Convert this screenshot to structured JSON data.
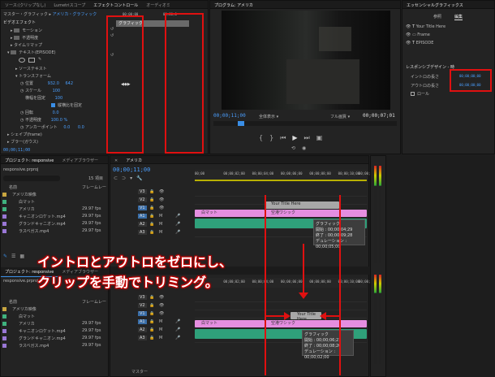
{
  "effect_controls": {
    "tabs": [
      "ソース:(クリップなし)",
      "Lumetriスコープ",
      "エフェクトコントロール",
      "オーディオミ"
    ],
    "master": "マスター・グラフィック",
    "clip": "アメリカ・グラフィック",
    "timecode_start": "00;00;00",
    "timecode_end": "00;00;0",
    "graphic_label": "グラフィック",
    "section_video": "ビデオエフェクト",
    "rows": [
      "モーション",
      "不透明度",
      "タイムリマップ",
      "テキスト(EPISODE)",
      "ソーステキスト",
      "トランスフォーム",
      "位置",
      "スケール",
      "横幅を固定",
      "回転",
      "不透明度",
      "アンカーポイント",
      "シェイプ(frame)",
      "ブラー(ガウス)"
    ],
    "position_x": "932.0",
    "position_y": "642",
    "scale": "100",
    "scale_w": "100",
    "rotation": "0.0",
    "opacity": "100.0 %",
    "anchor_x": "0.0",
    "anchor_y": "0.0",
    "checkbox_label": "縦横比を固定",
    "footer_timecode": "00;00;11;00"
  },
  "program": {
    "tab": "プログラム: アメリカ",
    "timecode": "00;00;11;00",
    "fit": "全体表示",
    "quality": "フル画質",
    "duration": "00;00;07;01"
  },
  "essential": {
    "tab": "エッセンシャルグラフィックス",
    "subtabs": [
      "参照",
      "編集"
    ],
    "layers": [
      "Your Title Here",
      "Frame",
      "EPISODE"
    ],
    "responsive_title": "レスポンシブデザイン - 時",
    "intro_label": "イントロの長さ",
    "intro_value": "00;00;00;00",
    "outro_label": "アウトロの長さ",
    "outro_value": "00;00;00;00",
    "roll_label": "ロール"
  },
  "project": {
    "tabs": [
      "プロジェクト: responsive",
      "メディアブラウザー"
    ],
    "file": "responsive.prproj",
    "count": "15 項目",
    "col_name": "名前",
    "col_rate": "フレームレー",
    "items": [
      {
        "name": "アメリカ映像",
        "rate": "",
        "color": "#c8a640"
      },
      {
        "name": "白マット",
        "rate": "",
        "color": "#3fb27f"
      },
      {
        "name": "アメリカ",
        "rate": "29.97 fps",
        "color": "#3fb27f"
      },
      {
        "name": "キャニオンロケット.mp4",
        "rate": "29.97 fps",
        "color": "#9a77d6"
      },
      {
        "name": "グランドキャニオン.mp4",
        "rate": "29.97 fps",
        "color": "#9a77d6"
      },
      {
        "name": "ラスベガス.mp4",
        "rate": "29.97 fps",
        "color": "#9a77d6"
      }
    ]
  },
  "timeline": {
    "tab": "アメリカ",
    "timecode": "00;00;11;00",
    "ruler": [
      "00;00",
      "00;00;02;00",
      "00;00;04;00",
      "00;00;06;00",
      "00;00;08;00",
      "00;00;10;00",
      "00;00;1"
    ],
    "tracks_v": [
      "V3",
      "V2",
      "V1"
    ],
    "tracks_a": [
      "A1",
      "A2",
      "A3"
    ],
    "title_clip": "Your Title Here",
    "video_clip": "白マット",
    "video_clip2": "空港ワシック",
    "tooltip_top": {
      "title": "グラフィック",
      "start": "開始 : 00;00;04;29",
      "end": "終了 : 00;00;09;28",
      "dur": "デュレーション : 00;00;05;00"
    },
    "tooltip_bottom": {
      "title": "グラフィック",
      "start": "開始 : 00;00;06;21",
      "end": "終了 : 00;00;08;20",
      "dur": "デュレーション : 00;00;02;00"
    },
    "master": "マスター"
  },
  "caption": {
    "line1": "イントロとアウトロをゼロにし、",
    "line2": "クリップを手動でトリミング。"
  }
}
